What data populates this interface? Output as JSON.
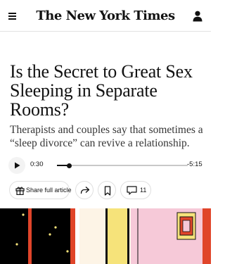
{
  "header": {
    "logo_text": "The New York Times",
    "menu_icon": "hamburger-menu-icon",
    "account_icon": "user-account-icon"
  },
  "article": {
    "headline": "Is the Secret to Great Sex Sleeping in Separate Rooms?",
    "summary": "Therapists and couples say that sometimes a “sleep divorce” can revive a relationship."
  },
  "audio": {
    "play_icon": "play-icon",
    "current_time": "0:30",
    "remaining_time": "-5:15",
    "progress_fraction": 0.09
  },
  "actions": {
    "share_label": "Share full article",
    "share_icon": "gift-icon",
    "forward_icon": "share-arrow-icon",
    "save_icon": "bookmark-icon",
    "comment_icon": "comment-bubble-icon",
    "comment_count": "11"
  },
  "colors": {
    "text": "#121212",
    "art_black": "#000000",
    "art_red": "#e0452a",
    "art_yellow": "#f6e37a",
    "art_cream": "#fdf4e6",
    "art_pink": "#f6c9d8"
  }
}
